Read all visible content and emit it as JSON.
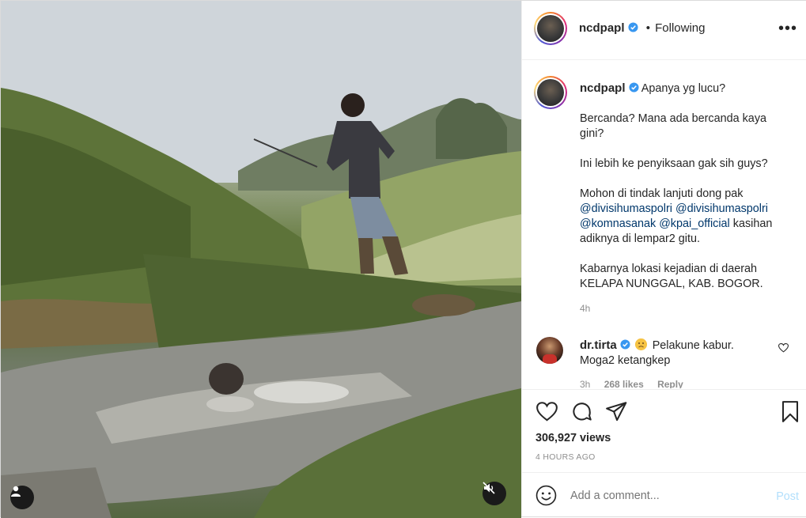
{
  "author": {
    "username": "ncdpapl",
    "verified": true,
    "follow_status": "Following",
    "separator": "•"
  },
  "icons": {
    "more": "more-options-icon",
    "verified": "verified-badge-icon",
    "like": "heart-icon",
    "comment": "comment-icon",
    "share": "paper-plane-icon",
    "save": "bookmark-icon",
    "emoji": "smiley-icon",
    "mute": "speaker-muted-icon",
    "tagged": "person-icon"
  },
  "caption": {
    "username": "ncdpapl",
    "line1": "Apanya yg lucu?",
    "para2": "Bercanda? Mana ada bercanda kaya gini?",
    "para3": "Ini lebih ke penyiksaan gak sih guys?",
    "para4_prefix": "Mohon di tindak lanjuti dong pak",
    "mention1": "@divisihumaspolri",
    "mention2": "@divisihumaspolri",
    "mention3": "@komnasanak",
    "mention4": "@kpai_official",
    "para4_suffix": "kasihan adiknya di lempar2 gitu.",
    "para5": "Kabarnya lokasi kejadian di daerah KELAPA NUNGGAL, KAB. BOGOR.",
    "time": "4h"
  },
  "comments": [
    {
      "username": "dr.tirta",
      "verified": true,
      "emoji": "sad-face-emoji",
      "text": "Pelakune kabur. Moga2 ketangkep",
      "time": "3h",
      "likes": "268 likes",
      "reply": "Reply"
    }
  ],
  "stats": {
    "views": "306,927 views",
    "posted": "4 HOURS AGO"
  },
  "add_comment": {
    "placeholder": "Add a comment...",
    "post_label": "Post"
  },
  "colors": {
    "link": "#00376b",
    "verified": "#3897f0",
    "muted_text": "#8e8e8e",
    "post_button_disabled": "#b2dffc"
  }
}
